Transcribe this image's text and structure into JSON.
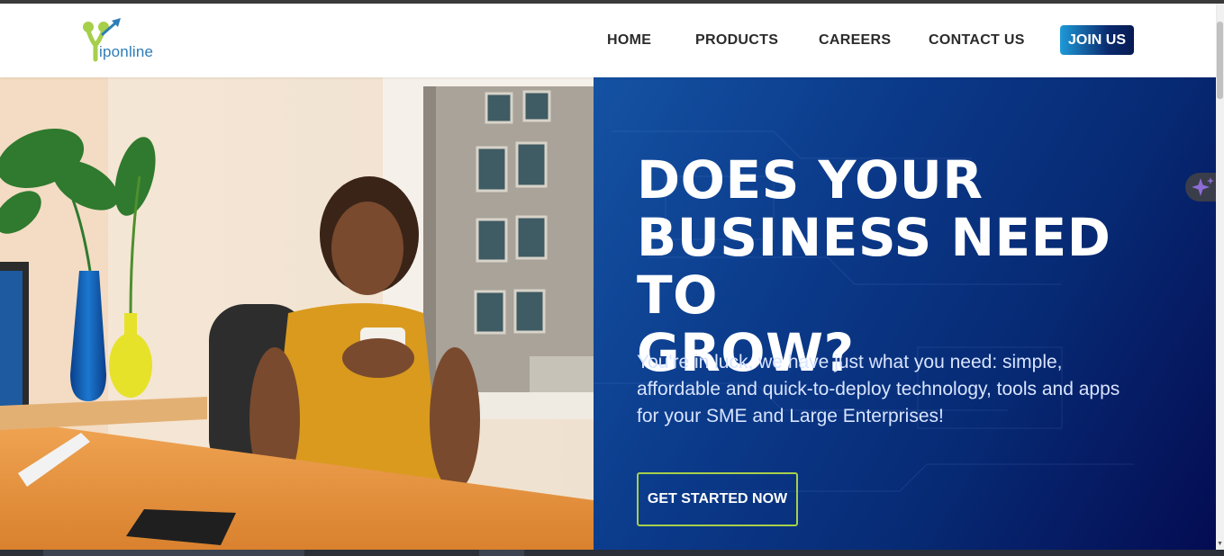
{
  "brand": {
    "logo_text": "iponline",
    "colors": {
      "primary_blue": "#2e7db8",
      "lime": "#a6cf4a",
      "navy": "#040c52"
    }
  },
  "nav": {
    "items": [
      {
        "label": "HOME"
      },
      {
        "label": "PRODUCTS"
      },
      {
        "label": "CAREERS"
      },
      {
        "label": "CONTACT US"
      }
    ],
    "join_label": "JOIN US"
  },
  "hero": {
    "headline_lines": [
      "DOES YOUR",
      "BUSINESS NEED TO",
      "GROW?"
    ],
    "subtext": "You're in luck, we have just what you need: simple, affordable and quick-to-deploy technology, tools and apps for your SME and Large Enterprises!",
    "cta_label": "GET STARTED NOW",
    "image_subject": "smiling woman in mustard top holding a coffee mug at an office desk"
  },
  "floating": {
    "icon": "sparkle-icon"
  }
}
